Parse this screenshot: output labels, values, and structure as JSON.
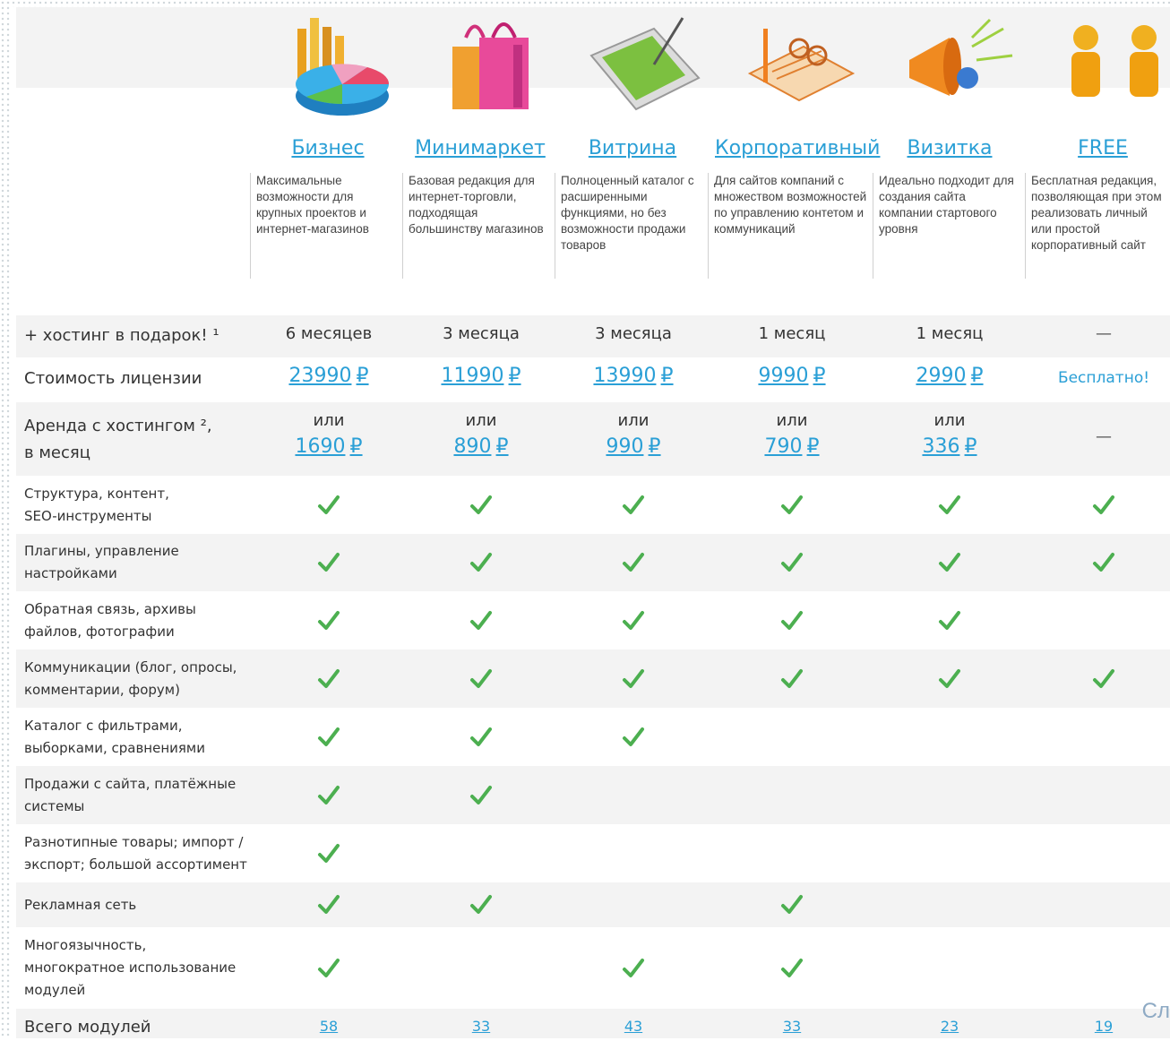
{
  "plans": [
    {
      "name": "Бизнес",
      "desc": "Максимальные возможности для крупных проектов и интернет-магазинов",
      "icon": "chart-pie-icon",
      "hosting": "6 месяцев",
      "price": "23990",
      "rent": "1690",
      "modules": "58"
    },
    {
      "name": "Минимаркет",
      "desc": "Базовая редакция для интернет-торговли, подходящая большинству магазинов",
      "icon": "shopping-bags-icon",
      "hosting": "3 месяца",
      "price": "11990",
      "rent": "890",
      "modules": "33"
    },
    {
      "name": "Витрина",
      "desc": "Полноценный каталог с расширенными функциями, но без возможности продажи товаров",
      "icon": "tablet-pen-icon",
      "hosting": "3 месяца",
      "price": "13990",
      "rent": "990",
      "modules": "43"
    },
    {
      "name": "Корпоративный",
      "desc": "Для сайтов компаний с множеством возможностей по управлению контетом и коммуникаций",
      "icon": "notepad-glasses-icon",
      "hosting": "1 месяц",
      "price": "9990",
      "rent": "790",
      "modules": "33"
    },
    {
      "name": "Визитка",
      "desc": "Идеально подходит для создания сайта компании стартового уровня",
      "icon": "megaphone-icon",
      "hosting": "1 месяц",
      "price": "2990",
      "rent": "336",
      "modules": "23"
    },
    {
      "name": "FREE",
      "desc": "Бесплатная редакция, позволяющая при этом реализовать личный или простой корпоративный сайт",
      "icon": "people-icon",
      "hosting": "—",
      "price": "Бесплатно!",
      "rent": "—",
      "modules": "19"
    }
  ],
  "labels": {
    "hosting": "+ хостинг в подарок! ¹",
    "license": "Стоимость лицензии",
    "rent_line1": "Аренда с хостингом ²,",
    "rent_line2": "в месяц",
    "or": "или",
    "currency": "₽",
    "total_modules": "Всего модулей",
    "corner_text": "Сл"
  },
  "features": [
    {
      "line1": "Структура, контент,",
      "line2": "SEO-инструменты",
      "checks": [
        true,
        true,
        true,
        true,
        true,
        true
      ]
    },
    {
      "line1": "Плагины, управление",
      "line2": "настройками",
      "checks": [
        true,
        true,
        true,
        true,
        true,
        true
      ]
    },
    {
      "line1": "Обратная связь, архивы",
      "line2": "файлов, фотографии",
      "checks": [
        true,
        true,
        true,
        true,
        true,
        false
      ]
    },
    {
      "line1": "Коммуникации (блог, опросы,",
      "line2": "комментарии, форум)",
      "checks": [
        true,
        true,
        true,
        true,
        true,
        true
      ]
    },
    {
      "line1": "Каталог с фильтрами,",
      "line2": "выборками, сравнениями",
      "checks": [
        true,
        true,
        true,
        false,
        false,
        false
      ]
    },
    {
      "line1": "Продажи с сайта, платёжные",
      "line2": "системы",
      "checks": [
        true,
        true,
        false,
        false,
        false,
        false
      ]
    },
    {
      "line1": "Разнотипные товары; импорт /",
      "line2": "экспорт; большой ассортимент",
      "checks": [
        true,
        false,
        false,
        false,
        false,
        false
      ]
    },
    {
      "line1": "Рекламная сеть",
      "line2": "",
      "checks": [
        true,
        true,
        false,
        true,
        false,
        false
      ]
    },
    {
      "line1": "Многоязычность,",
      "line2": "многократное использование",
      "line3": "модулей",
      "checks": [
        true,
        false,
        true,
        true,
        false,
        false
      ]
    }
  ],
  "colors": {
    "link": "#2a9fd6",
    "row_gray": "#f3f3f3",
    "check_green": "#4caf50"
  }
}
